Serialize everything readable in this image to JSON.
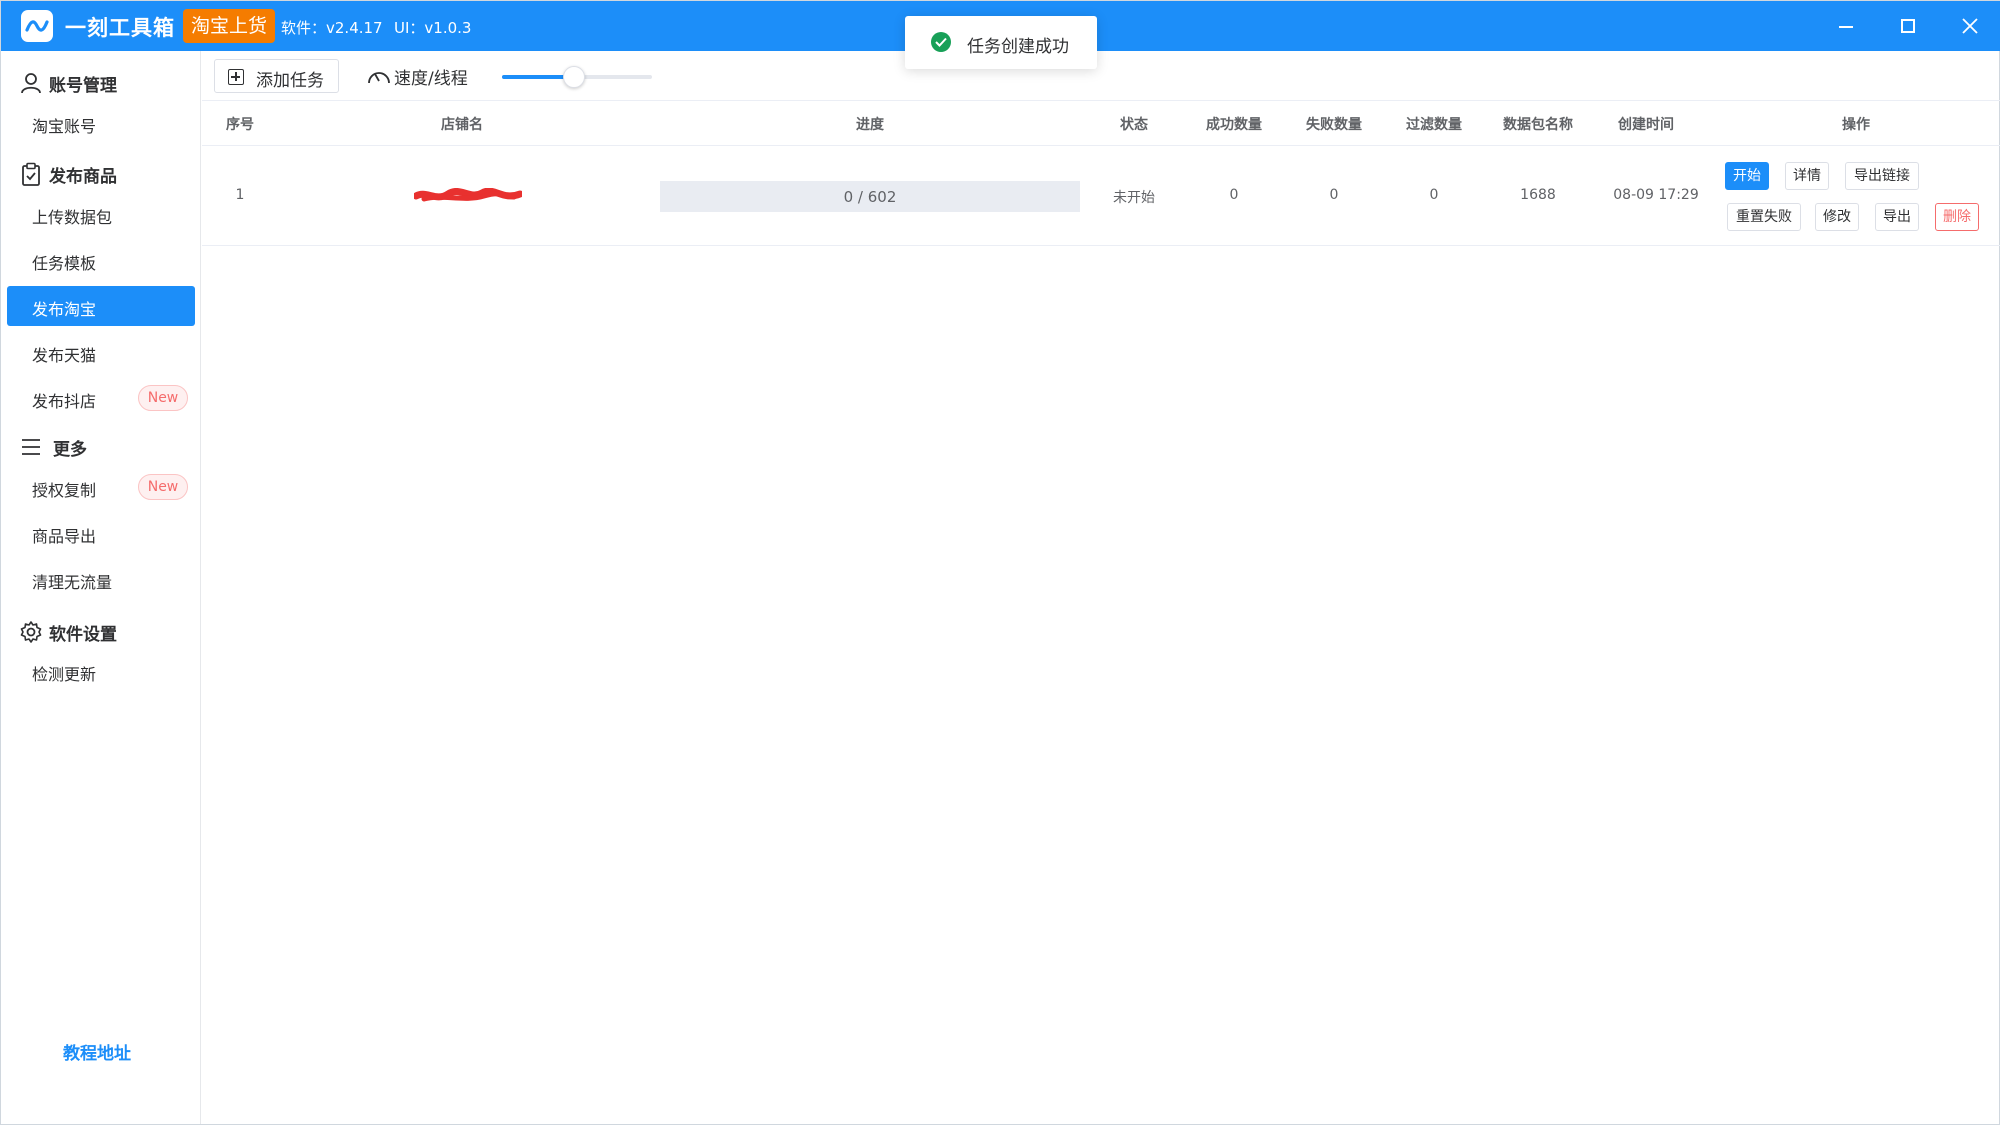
{
  "app": {
    "title": "一刻工具箱 .",
    "badge": "淘宝上货",
    "software_version": "软件：v2.4.17",
    "ui_version": "UI：v1.0.3"
  },
  "sidebar": {
    "sections": [
      {
        "title": "账号管理",
        "icon": "user-icon",
        "items": [
          {
            "label": "淘宝账号"
          }
        ]
      },
      {
        "title": "发布商品",
        "icon": "clipboard-icon",
        "items": [
          {
            "label": "上传数据包"
          },
          {
            "label": "任务模板"
          },
          {
            "label": "发布淘宝",
            "active": true
          },
          {
            "label": "发布天猫"
          },
          {
            "label": "发布抖店",
            "badge": "New"
          }
        ]
      },
      {
        "title": "更多",
        "icon": "menu-icon",
        "items": [
          {
            "label": "授权复制",
            "badge": "New"
          },
          {
            "label": "商品导出"
          },
          {
            "label": "清理无流量"
          }
        ]
      },
      {
        "title": "软件设置",
        "icon": "gear-icon",
        "items": [
          {
            "label": "检测更新"
          }
        ]
      }
    ],
    "footer_link": "教程地址"
  },
  "toolbar": {
    "add_task": "添加任务",
    "speed_label": "速度/线程",
    "speed_level": 0.48
  },
  "toast": {
    "message": "任务创建成功",
    "icon": "check-circle-icon"
  },
  "table": {
    "headers": [
      "序号",
      "店铺名",
      "进度",
      "状态",
      "成功数量",
      "失败数量",
      "过滤数量",
      "数据包名称",
      "创建时间",
      "操作"
    ],
    "rows": [
      {
        "index": "1",
        "shop": "",
        "progress_text": "0 / 602",
        "progress_fraction": 0,
        "status": "未开始",
        "success": "0",
        "failed": "0",
        "filtered": "0",
        "package": "1688",
        "created": "08-09 17:29",
        "actions": [
          "开始",
          "详情",
          "导出链接",
          "重置失败",
          "修改",
          "导出",
          "删除"
        ]
      }
    ]
  },
  "colors": {
    "primary": "#1c8ef9",
    "badge_orange": "#f57c00",
    "danger": "#f56c6c",
    "success": "#18a058",
    "redaction": "#e8312f"
  }
}
